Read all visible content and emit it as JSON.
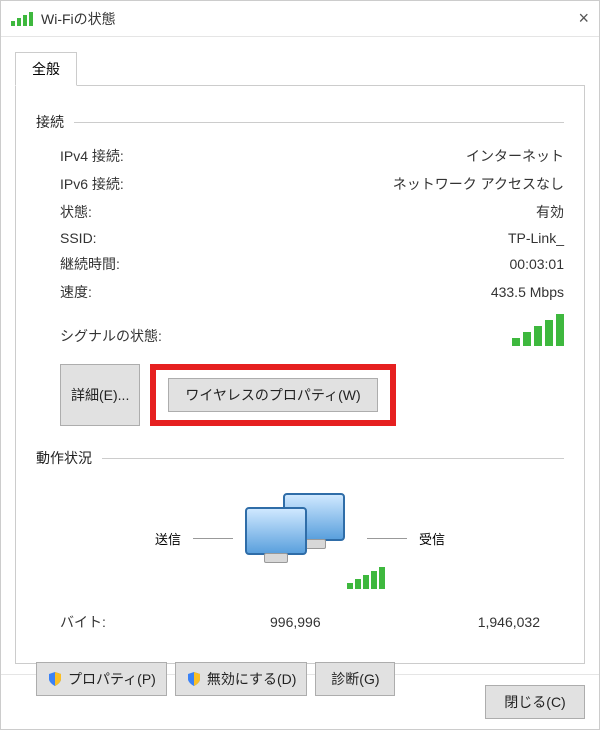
{
  "window": {
    "title": "Wi-Fiの状態"
  },
  "tabs": {
    "general": "全般"
  },
  "connection": {
    "section_label": "接続",
    "rows": {
      "ipv4": {
        "label": "IPv4 接続:",
        "value": "インターネット"
      },
      "ipv6": {
        "label": "IPv6 接続:",
        "value": "ネットワーク アクセスなし"
      },
      "status": {
        "label": "状態:",
        "value": "有効"
      },
      "ssid": {
        "label": "SSID:",
        "value": "TP-Link_"
      },
      "duration": {
        "label": "継続時間:",
        "value": "00:03:01"
      },
      "speed": {
        "label": "速度:",
        "value": "433.5 Mbps"
      },
      "signal": {
        "label": "シグナルの状態:"
      }
    },
    "buttons": {
      "details": "詳細(E)...",
      "wireless_props": "ワイヤレスのプロパティ(W)"
    }
  },
  "activity": {
    "section_label": "動作状況",
    "sent_label": "送信",
    "recv_label": "受信",
    "bytes_label": "バイト:",
    "bytes_sent": "996,996",
    "bytes_recv": "1,946,032"
  },
  "buttons": {
    "properties": "プロパティ(P)",
    "disable": "無効にする(D)",
    "diagnose": "診断(G)",
    "close": "閉じる(C)"
  }
}
